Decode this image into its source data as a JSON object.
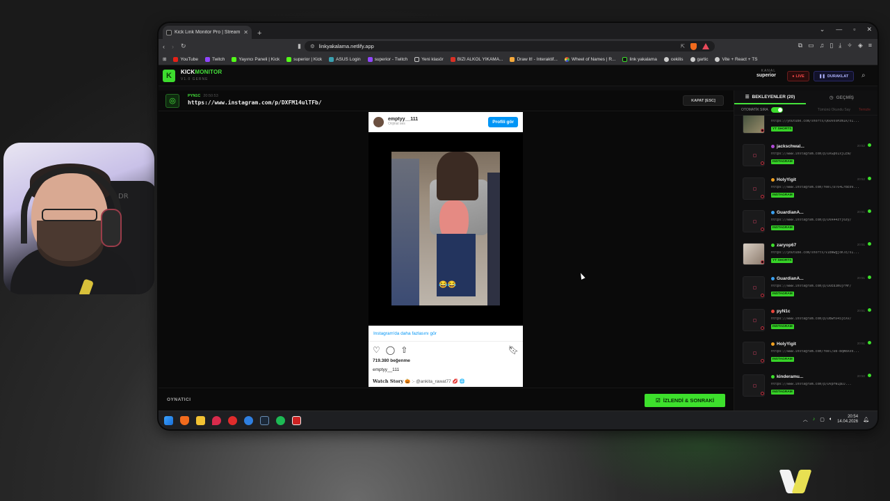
{
  "browser": {
    "tab_title": "Kick Link Monitor Pro | Stream",
    "url": "linkyakalama.netlify.app",
    "bookmarks": [
      "YouTube",
      "Twitch",
      "Yayıncı Paneli | Kick",
      "superior | Kick",
      "ASUS Login",
      "superior - Twitch",
      "Yeni klasör",
      "BIZI ALKOL YIKAMA...",
      "Draw It! - Interaktif...",
      "Wheel of Names | R...",
      "link yakalama",
      "cekilis",
      "gartic",
      "Vite + React + TS"
    ]
  },
  "app": {
    "logo_letter": "K",
    "brand_a": "KICK",
    "brand_b": "MONITOR",
    "brand_sub": "V1.0 GERNE",
    "kanal_label": "KANAL",
    "kanal_value": "superior",
    "live_label": "LIVE",
    "pause_label": "DURAKLAT"
  },
  "current": {
    "user": "PYN1C",
    "time": "20:50:53",
    "url": "https://www.instagram.com/p/DXFM14ulTFb/",
    "close_label": "KAPAT [ESC]"
  },
  "embed": {
    "username": "emptyy__111",
    "subtitle": "Orijinal ses",
    "profile_btn": "Profili gör",
    "more_link": "Instagram'da daha fazlasını gör",
    "likes": "719.380 beğenme",
    "user2": "emptyy__111",
    "caption_bold": "Watch Story",
    "caption_rest": "🎃 :- @ankita_rawat77 💋 🌐"
  },
  "player": {
    "label": "OYNATICI",
    "next_label": "İZLENDİ & SONRAKİ"
  },
  "sidebar": {
    "tab_waiting": "BEKLEYENLER (20)",
    "tab_history": "GEÇMİŞ",
    "auto_label": "OTOMATİK SIRA",
    "mark_all": "Tümünü Okundu Say",
    "clear": "Temizle",
    "queue": [
      {
        "name": "",
        "url": "https://youtube.com/shorts/Q6OvosMzmIk/sI...",
        "badge": "YT SHORTS",
        "time": "",
        "thumb": "img2",
        "color": ""
      },
      {
        "name": "jackschwal...",
        "url": "https://www.instagram.com/p/DXGp01xjLEN/",
        "badge": "INSTAGRAM",
        "time": "20:52",
        "thumb": "",
        "color": "#b14bd8"
      },
      {
        "name": "HolyYigit",
        "url": "https://www.instagram.com/reel/DT64LrBE09...",
        "badge": "INSTAGRAM",
        "time": "20:52",
        "thumb": "",
        "color": "#f0a020"
      },
      {
        "name": "GuardianA...",
        "url": "https://www.instagram.com/p/DVR44zfj6zy/",
        "badge": "INSTAGRAM",
        "time": "20:51",
        "thumb": "",
        "color": "#3aa0f0"
      },
      {
        "name": "zaryop67",
        "url": "https://youtube.com/shorts/VIBNwgjoKTE/sI...",
        "badge": "YT SHORTS",
        "time": "20:51",
        "thumb": "img",
        "color": "#3de02c"
      },
      {
        "name": "GuardianA...",
        "url": "https://www.instagram.com/p/DUE83mUjFMF/",
        "badge": "INSTAGRAM",
        "time": "20:51",
        "thumb": "",
        "color": "#3aa0f0"
      },
      {
        "name": "pyN1c",
        "url": "https://www.instagram.com/p/DBwFD45jEXv/",
        "badge": "INSTAGRAM",
        "time": "20:51",
        "thumb": "",
        "color": "#e8443a"
      },
      {
        "name": "HolyYigit",
        "url": "https://www.instagram.com/reel/DB-BqWdXs0...",
        "badge": "INSTAGRAM",
        "time": "20:51",
        "thumb": "",
        "color": "#f0a020"
      },
      {
        "name": "kinderamu...",
        "url": "https://www.instagram.com/p/DVpFW1pDJ...",
        "badge": "INSTAGRAM",
        "time": "20:50",
        "thumb": "",
        "color": "#3de02c"
      }
    ]
  },
  "taskbar": {
    "time": "20:54",
    "date": "14.04.2026"
  }
}
